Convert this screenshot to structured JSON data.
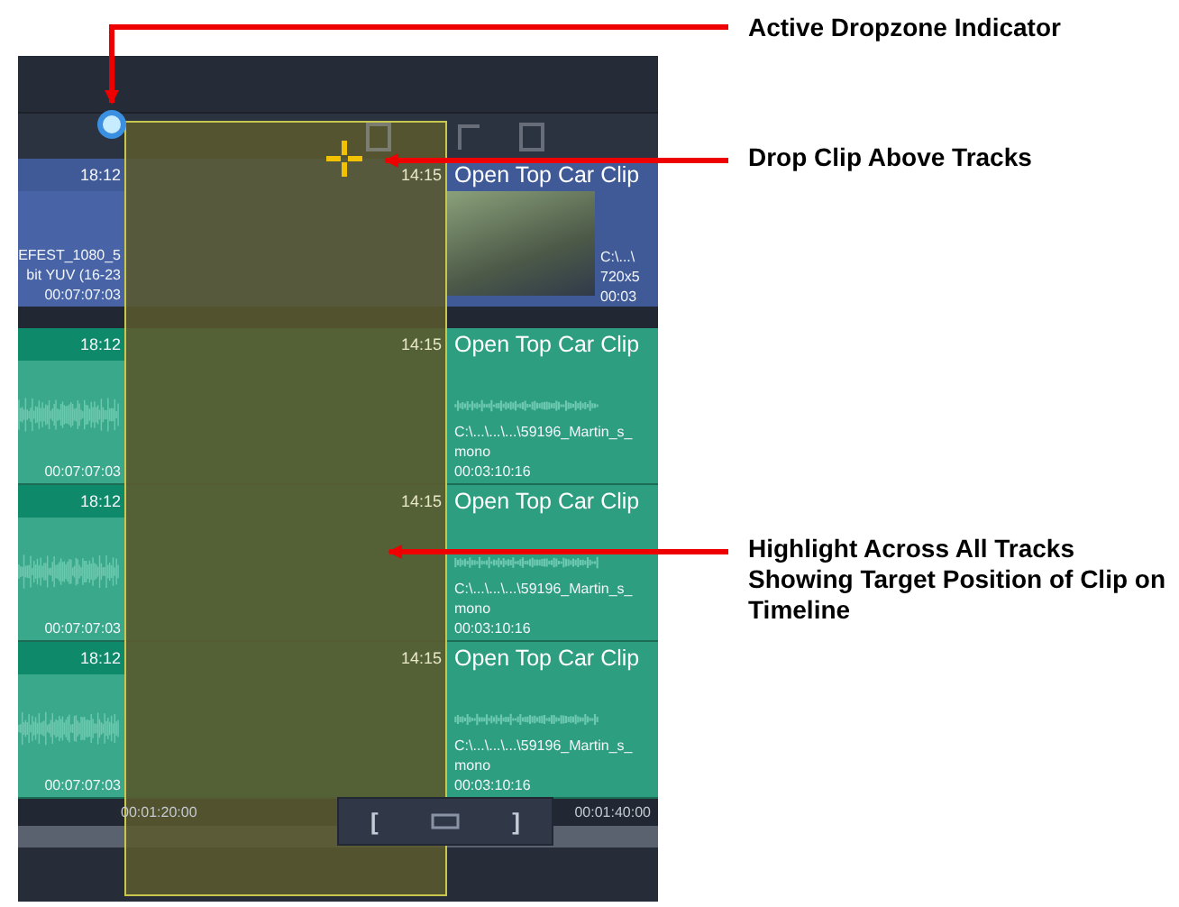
{
  "callouts": [
    {
      "text": "Active Dropzone Indicator"
    },
    {
      "text": "Drop Clip Above Tracks"
    },
    {
      "text": "Highlight Across All Tracks Showing Target Position of Clip on Timeline"
    }
  ],
  "tracks": [
    {
      "kind": "video",
      "left_clip": {
        "time": "18:12",
        "lines": [
          "EFEST_1080_5",
          "bit YUV (16-23",
          "00:07:07:03"
        ]
      },
      "right_clip": {
        "time": "14:15",
        "title": "Open Top Car Clip",
        "lines": [
          "C:\\...\\",
          "720x5",
          "00:03"
        ]
      }
    },
    {
      "kind": "audio",
      "left_clip": {
        "time": "18:12",
        "lines": [
          "00:07:07:03"
        ]
      },
      "right_clip": {
        "time": "14:15",
        "title": "Open Top Car Clip",
        "lines": [
          "C:\\...\\...\\...\\59196_Martin_s_",
          "mono",
          "00:03:10:16"
        ]
      }
    },
    {
      "kind": "audio",
      "left_clip": {
        "time": "18:12",
        "lines": [
          "00:07:07:03"
        ]
      },
      "right_clip": {
        "time": "14:15",
        "title": "Open Top Car Clip",
        "lines": [
          "C:\\...\\...\\...\\59196_Martin_s_",
          "mono",
          "00:03:10:16"
        ]
      }
    },
    {
      "kind": "audio",
      "left_clip": {
        "time": "18:12",
        "lines": [
          "00:07:07:03"
        ]
      },
      "right_clip": {
        "time": "14:15",
        "title": "Open Top Car Clip",
        "lines": [
          "C:\\...\\...\\...\\59196_Martin_s_",
          "mono",
          "00:03:10:16"
        ]
      }
    }
  ],
  "ruler": {
    "labels": [
      "00:01:20:00",
      "00:01:40:00"
    ]
  },
  "zoom_controls": {
    "in_mark": "[",
    "out_mark": "]"
  }
}
